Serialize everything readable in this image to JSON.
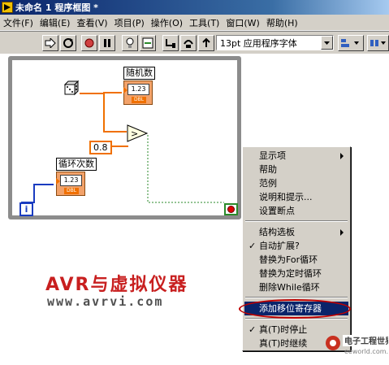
{
  "window": {
    "title": "未命名 1 程序框图 *"
  },
  "menubar": {
    "items": [
      "文件(F)",
      "编辑(E)",
      "查看(V)",
      "项目(P)",
      "操作(O)",
      "工具(T)",
      "窗口(W)",
      "帮助(H)"
    ]
  },
  "toolbar": {
    "font_select": "13pt 应用程序字体",
    "buttons": [
      "run-arrow-icon",
      "run-continuous-icon",
      "abort-icon",
      "pause-icon",
      "highlight-execution-icon",
      "retain-wire-values-icon",
      "step-into-icon",
      "step-over-icon",
      "step-out-icon",
      "align-icon",
      "distribute-icon"
    ]
  },
  "diagram": {
    "random_label": "随机数",
    "random_value": "1.23",
    "random_type": "DBL",
    "iteration_label": "循环次数",
    "iteration_value": "1.23",
    "iteration_type": "DBL",
    "constant_value": "0.8",
    "iteration_terminal": "i",
    "wire_color": "#f07000",
    "stop_color": "#2a8a2a"
  },
  "context_menu": {
    "items": [
      {
        "label": "显示项",
        "submenu": true
      },
      {
        "label": "帮助"
      },
      {
        "label": "范例"
      },
      {
        "label": "说明和提示..."
      },
      {
        "label": "设置断点"
      },
      {
        "label": "结构选板",
        "submenu": true
      },
      {
        "label": "自动扩展?",
        "checked": true
      },
      {
        "label": "替换为For循环"
      },
      {
        "label": "替换为定时循环"
      },
      {
        "label": "删除While循环"
      },
      {
        "label": "添加移位寄存器",
        "selected": true
      },
      {
        "label": "真(T)时停止",
        "checked": true
      },
      {
        "label": "真(T)时继续"
      }
    ]
  },
  "watermark": {
    "line1": "AVR与虚拟仪器",
    "line2": "www.avrvi.com",
    "color": "#c81f1f"
  },
  "logo": {
    "name": "电子工程世界",
    "url_text": "eeworld.com.cn"
  }
}
